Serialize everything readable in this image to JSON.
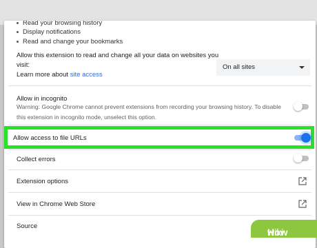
{
  "permissions": [
    "Read your browsing history",
    "Display notifications",
    "Read and change your bookmarks"
  ],
  "site_access": {
    "text_line1": "Allow this extension to read and change all your data on websites you",
    "text_line2": "visit:",
    "learn_more_prefix": "Learn more about ",
    "learn_more_link": "site access",
    "select_value": "On all sites"
  },
  "incognito": {
    "title": "Allow in incognito",
    "warning_line1": "Warning: Google Chrome cannot prevent extensions from recording your browsing history. To disable",
    "warning_line2": "this extension in incognito mode, unselect this option.",
    "enabled": false
  },
  "file_urls": {
    "title": "Allow access to file URLs",
    "enabled": true
  },
  "collect_errors": {
    "title": "Collect errors",
    "enabled": false
  },
  "extension_options": {
    "title": "Extension options"
  },
  "web_store": {
    "title": "View in Chrome Web Store"
  },
  "source": {
    "title": "Source"
  },
  "watermark": {
    "prefix": "wiki",
    "suffix": "How"
  },
  "colors": {
    "highlight": "#2be02b",
    "toggle_on": "#1a73e8",
    "link": "#3367d6"
  }
}
